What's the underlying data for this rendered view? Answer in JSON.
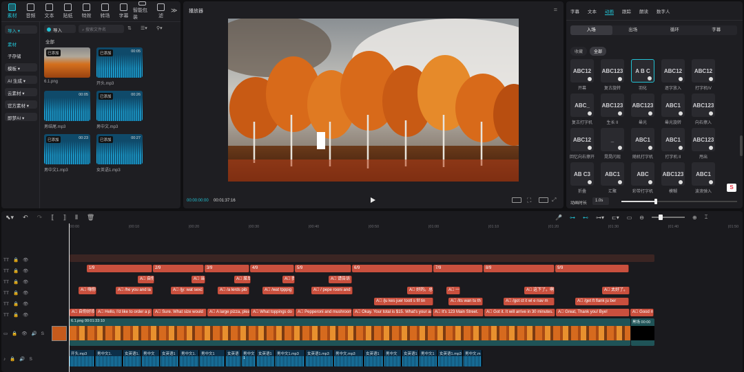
{
  "toolbar": {
    "tools": [
      {
        "label": "素材",
        "active": true
      },
      {
        "label": "音频"
      },
      {
        "label": "文本"
      },
      {
        "label": "贴纸"
      },
      {
        "label": "特效"
      },
      {
        "label": "转场"
      },
      {
        "label": "字幕"
      },
      {
        "label": "智能包装"
      },
      {
        "label": "滤"
      }
    ],
    "more": "≫"
  },
  "left_nav": {
    "import": "导入",
    "items": [
      "素材",
      "子存储",
      "模板",
      "AI 生成",
      "云素材",
      "官方素材",
      "即梦AI"
    ]
  },
  "media_panel": {
    "import_btn": "导入",
    "search_placeholder": "搜索文件名",
    "filter": "全部",
    "items": [
      {
        "name": "6.1.png",
        "tag": "已添加",
        "duration": "",
        "type": "image"
      },
      {
        "name": "开头.mp3",
        "tag": "已添加",
        "duration": "00:05",
        "type": "audio"
      },
      {
        "name": "男结尾.mp3",
        "tag": "",
        "duration": "00:05",
        "type": "audio"
      },
      {
        "name": "男中文.mp3",
        "tag": "已添加",
        "duration": "00:26",
        "type": "audio"
      },
      {
        "name": "男中文1.mp3",
        "tag": "已添加",
        "duration": "00:23",
        "type": "audio"
      },
      {
        "name": "女英语1.mp3",
        "tag": "已添加",
        "duration": "00:27",
        "type": "audio"
      }
    ]
  },
  "player": {
    "title": "播放器",
    "current_time": "00:00:00:00",
    "total_time": "00:01:37:16"
  },
  "right_panel": {
    "tabs": [
      "字幕",
      "文本",
      "动画",
      "跟踪",
      "朗读",
      "数字人"
    ],
    "active_tab": "动画",
    "sub_tabs": [
      "入场",
      "出场",
      "循环",
      "字幕"
    ],
    "filters": [
      "收藏",
      "全部"
    ],
    "tiles": [
      {
        "label": "开幕",
        "glyph": "ABC12"
      },
      {
        "label": "复古旋转",
        "glyph": "ABC123"
      },
      {
        "label": "羽化",
        "glyph": "A B C"
      },
      {
        "label": "逐字放入",
        "glyph": "ABC12"
      },
      {
        "label": "打字机IV",
        "glyph": "ABC12"
      },
      {
        "label": "复古打字机",
        "glyph": "ABC_"
      },
      {
        "label": "生长 II",
        "glyph": "ABC123"
      },
      {
        "label": "晕光",
        "glyph": "ABC123"
      },
      {
        "label": "晕光旋转",
        "glyph": "ABC1"
      },
      {
        "label": "向右擦入",
        "glyph": "ABC123"
      },
      {
        "label": "回忆向右擦开",
        "glyph": "ABC12"
      },
      {
        "label": "晃晃闪现",
        "glyph": "_"
      },
      {
        "label": "随机打字机",
        "glyph": "ABC1"
      },
      {
        "label": "打字机 II",
        "glyph": "ABC1"
      },
      {
        "label": "甩出",
        "glyph": "ABC123"
      },
      {
        "label": "折叠",
        "glyph": "AB C3"
      },
      {
        "label": "汇聚",
        "glyph": "ABC1"
      },
      {
        "label": "彩带打字机",
        "glyph": "ABC"
      },
      {
        "label": "模糊",
        "glyph": "ABC123"
      },
      {
        "label": "波浪弹入",
        " glyph": "ABC1"
      }
    ],
    "duration_label": "动画时长",
    "duration_value": "1.0s"
  },
  "timeline": {
    "ticks": [
      "00:00",
      "00:10",
      "00:20",
      "00:30",
      "00:40",
      "00:50",
      "01:00",
      "01:10",
      "01:20",
      "01:30",
      "01:40",
      "01:50"
    ],
    "numbered": [
      "1/9",
      "2/9",
      "3/9",
      "4/9",
      "5/9",
      "6/9",
      "7/9",
      "8/9",
      "9/9"
    ],
    "row3": [
      "自你",
      "当然",
      "菜单",
      "我",
      "请告诉"
    ],
    "row4": [
      "嗨你",
      "/he you and la",
      "/jy: wat sexc",
      "/a lerds pib",
      "/wat tpppig",
      "/ pepe rooni and",
      "好的。总价",
      "一",
      "这下了。啊",
      "太好了。"
    ],
    "row5": [
      "/ju kes juer tootl s fif tin",
      "/its wan tu th",
      "/got ct it wl e nav m",
      "/get ft flank ju ber"
    ],
    "row6": [
      "自你好欢迎",
      "Hello, I'd like to order a p",
      "Sure. What size would",
      "A large pizza, pleas",
      "What toppings do",
      "Pepperoni and mushroom",
      "Okay. Your total is $15. What's your ad",
      "It's 123 Main Street.",
      "Got it. It will arrive in 30 minutes.",
      "Great, Thank you! Bye!",
      "Good morni"
    ],
    "video": {
      "name": "6.1.png",
      "duration": "00:01:33:10",
      "end_label": "黑场",
      "end_time": "00:00"
    },
    "audio": [
      "开头.mp3",
      "男中文1.",
      "女英语1.",
      "男中文",
      "女英语1",
      "男中文1.",
      "男中文1",
      "女英语",
      "男中文1",
      "女英语1",
      "男中文1.mp3",
      "女英语1.mp3",
      "男中文.mp3",
      "女英语1",
      "男中文",
      "女英语1",
      "男中文1",
      "女英语1.mp3",
      "男中文.m"
    ]
  }
}
